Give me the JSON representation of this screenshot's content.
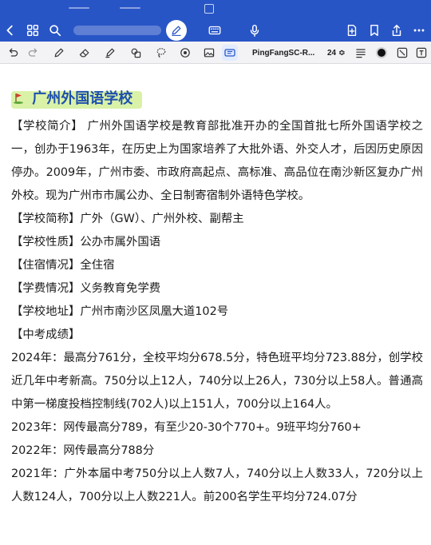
{
  "toolbar": {
    "font_name": "PingFangSC-R...",
    "font_size": "24",
    "font_size_arrow": "≎"
  },
  "doc": {
    "title": "广州外国语学校",
    "intro_label": "【学校简介】",
    "intro_text": " 广州外国语学校是教育部批准开办的全国首批七所外国语学校之一，创办于1963年，在历史上为国家培养了大批外语、外交人才，后因历史原因停办。2009年，广州市委、市政府高起点、高标准、高品位在南沙新区复办广州外校。现为广州市市属公办、全日制寄宿制外语特色学校。",
    "abbr_label": "【学校简称】",
    "abbr_text": "广外（GW）、广州外校、副帮主",
    "nature_label": "【学校性质】",
    "nature_text": "公办市属外国语",
    "board_label": "【住宿情况】",
    "board_text": "全住宿",
    "fee_label": "【学费情况】",
    "fee_text": "义务教育免学费",
    "addr_label": "【学校地址】",
    "addr_text": "广州市南沙区凤凰大道102号",
    "exam_label": "【中考成绩】",
    "y2024": "2024年：最高分761分，全校平均分678.5分，特色班平均分723.88分，创学校近几年中考新高。750分以上12人，740分以上26人，730分以上58人。普通高中第一梯度投档控制线(702人)以上151人，700分以上164人。",
    "y2023": "2023年：网传最高分789，有至少20-30个770+。9班平均分760+",
    "y2022": "2022年：网传最高分788分",
    "y2021": "2021年：广外本届中考750分以上人数7人，740分以上人数33人，720分以上人数124人，700分以上人数221人。前200名学生平均分724.07分"
  },
  "colors": {
    "bar_blue": "#2855c6",
    "title_blue": "#1f4fae",
    "highlight": "#d9f2a8"
  }
}
